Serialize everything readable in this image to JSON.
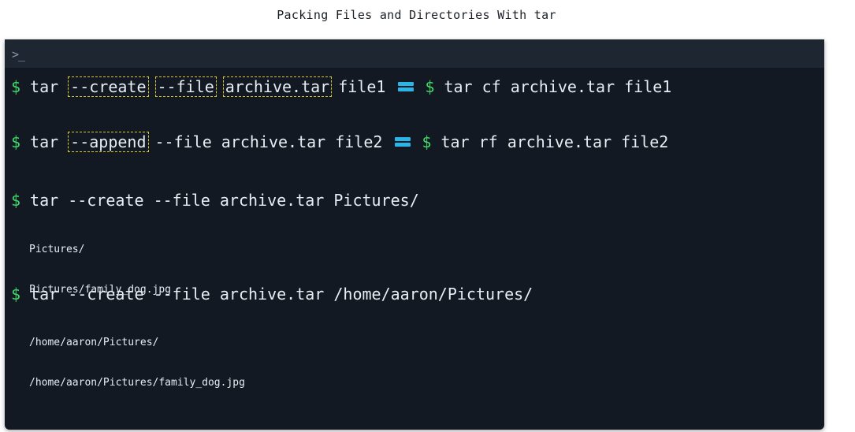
{
  "page_title": "Packing Files and Directories With tar",
  "terminal": {
    "prompt_icon": ">_",
    "commands": [
      {
        "prompt": "$",
        "parts": [
          "tar",
          "--create",
          "--file",
          "archive.tar",
          "file1"
        ],
        "equals_prompt": "$",
        "equals_parts": [
          "tar",
          "cf",
          "archive.tar",
          "file1"
        ]
      },
      {
        "prompt": "$",
        "parts": [
          "tar",
          "--append",
          "--file",
          "archive.tar",
          "file2"
        ],
        "equals_prompt": "$",
        "equals_parts": [
          "tar",
          "rf",
          "archive.tar",
          "file2"
        ]
      },
      {
        "prompt": "$",
        "text": "tar --create --file archive.tar Pictures/",
        "output": [
          "Pictures/",
          "Pictures/family_dog.jpg"
        ]
      },
      {
        "prompt": "$",
        "text": "tar --create --file archive.tar /home/aaron/Pictures/",
        "output": [
          "/home/aaron/Pictures/",
          "/home/aaron/Pictures/family_dog.jpg"
        ]
      }
    ]
  },
  "colors": {
    "terminal_bg": "#121922",
    "header_bg": "#1e2631",
    "prompt_green": "#40d86a",
    "highlight_border": "#d8c832",
    "equals_blue": "#29b6e6"
  }
}
